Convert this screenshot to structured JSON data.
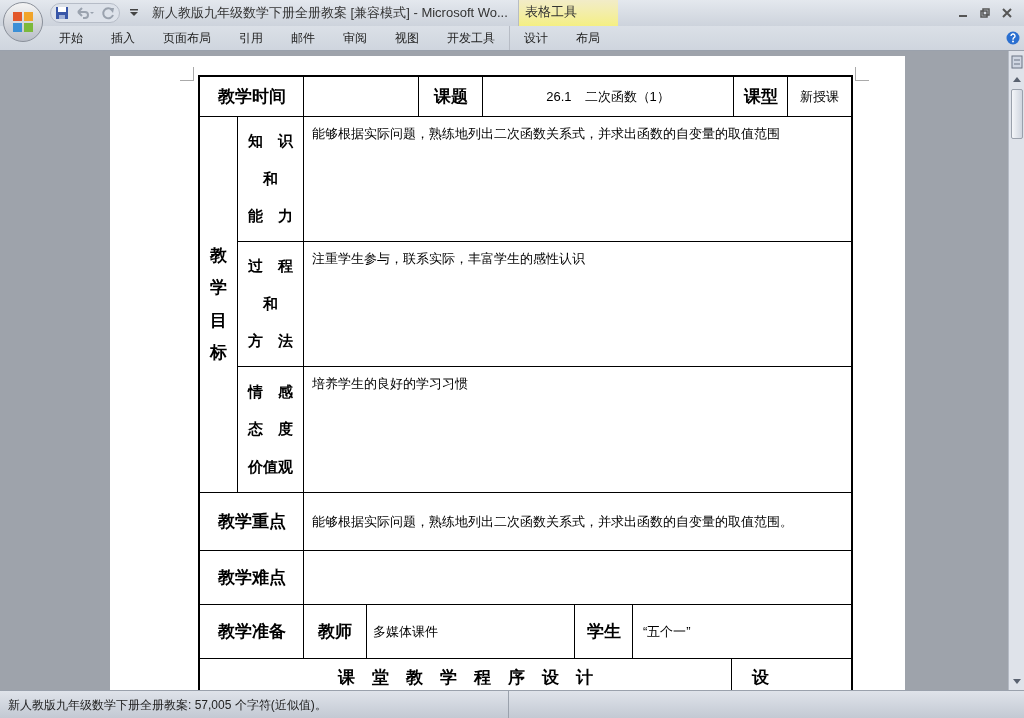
{
  "window": {
    "title": "新人教版九年级数学下册全册教案 [兼容模式] - Microsoft Wo...",
    "contextual_tab_group": "表格工具"
  },
  "ribbon_tabs": [
    "开始",
    "插入",
    "页面布局",
    "引用",
    "邮件",
    "审阅",
    "视图",
    "开发工具"
  ],
  "table_tools_tabs": [
    "设计",
    "布局"
  ],
  "lesson_table": {
    "header": {
      "time_label": "教学时间",
      "topic_label": "课题",
      "topic": "26.1　二次函数（1）",
      "type_label": "课型",
      "type": "新授课"
    },
    "objectives": {
      "label": "教学目标",
      "items": [
        {
          "label_lines": [
            "知　识",
            "和",
            "能　力"
          ],
          "text": "能够根据实际问题，熟练地列出二次函数关系式，并求出函数的自变量的取值范围"
        },
        {
          "label_lines": [
            "过　程",
            "和",
            "方　法"
          ],
          "text": "注重学生参与，联系实际，丰富学生的感性认识"
        },
        {
          "label_lines": [
            "情　感",
            "态　度",
            "价值观"
          ],
          "text": "培养学生的良好的学习习惯"
        }
      ]
    },
    "rows": [
      {
        "label": "教学重点",
        "text": "能够根据实际问题，熟练地列出二次函数关系式，并求出函数的自变量的取值范围。"
      },
      {
        "label": "教学难点"
      }
    ],
    "preparation": {
      "label": "教学准备",
      "teacher_label": "教师",
      "teacher": "多媒体课件",
      "student_label": "学生",
      "student": "“五个一”"
    },
    "procedure": {
      "title": "课　堂　教　学　程　序　设　计",
      "side": "设"
    }
  },
  "status_bar": {
    "text": "新人教版九年级数学下册全册教案: 57,005 个字符(近似值)。"
  }
}
